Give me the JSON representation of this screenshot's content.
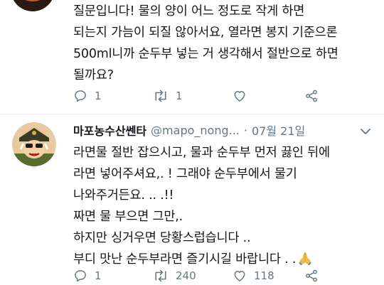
{
  "tweet1": {
    "lines": [
      "질문입니다! 물의 양이 어느 정도로 작게 하면",
      "되는지 가늠이 되질 않아서요, 열라면 봉지 기준으론",
      "500ml니까 순두부 넣는 거 생각해서 절반으로 하면",
      "될까요?"
    ],
    "actions": {
      "reply_count": "1",
      "retweet_count": "1"
    }
  },
  "tweet2": {
    "display_name": "마포농수산쎈타",
    "handle": "@mapo_nong...",
    "separator": "·",
    "date": "07월 21일",
    "lines": [
      "라면물 절반 잡으시고, 물과 순두부 먼저 끓인 뒤에",
      "라면 넣어주셔요,. ! 그래야 순두부에서 물기",
      "나와주거든요. .. .!!",
      "짜면 물 부으면 그만,.",
      "하지만 싱거우면 당황스럽습니다 ..",
      "부디 맛난 순두부라면 즐기시길 바랍니다 . ."
    ],
    "actions": {
      "reply_count": "1",
      "retweet_count": "240",
      "like_count": "118"
    }
  },
  "icons": {
    "reply": "reply-icon",
    "retweet": "retweet-icon",
    "like": "heart-icon",
    "share": "share-icon",
    "more": "chevron-down-icon",
    "emoji": "folded-hands-emoji"
  },
  "colors": {
    "text": "#14171a",
    "secondary": "#657786",
    "divider": "#e6ecf0"
  }
}
